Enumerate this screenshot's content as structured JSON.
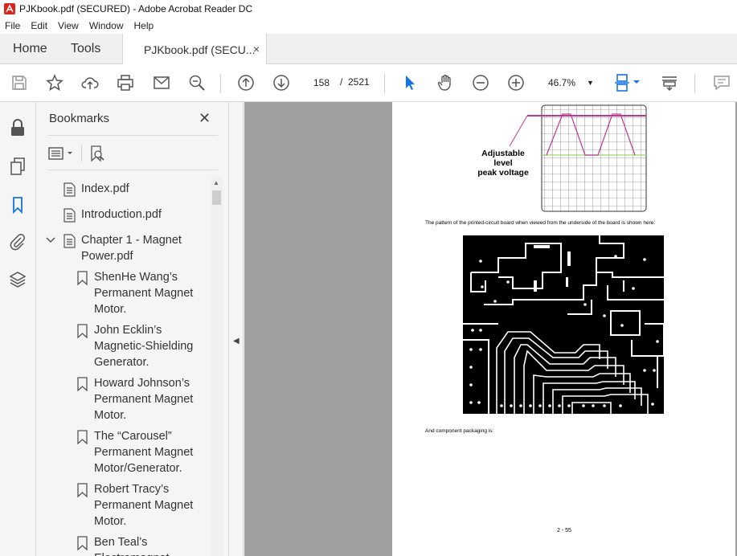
{
  "window": {
    "title": "PJKbook.pdf (SECURED) - Adobe Acrobat Reader DC"
  },
  "menu": [
    "File",
    "Edit",
    "View",
    "Window",
    "Help"
  ],
  "tabs": {
    "home": "Home",
    "tools": "Tools",
    "document": "PJKbook.pdf (SECU...",
    "close": "×"
  },
  "toolbar": {
    "page_current": "158",
    "page_sep": "/",
    "page_total": "2521",
    "zoom": "46.7%"
  },
  "bookmarks": {
    "title": "Bookmarks",
    "close": "✕",
    "items": [
      {
        "label": "Index.pdf"
      },
      {
        "label": "Introduction.pdf"
      },
      {
        "label": "Chapter 1 - Magnet Power.pdf"
      },
      {
        "label": "ShenHe Wang’s Permanent Magnet Motor."
      },
      {
        "label": "John Ecklin’s Magnetic-Shielding Generator."
      },
      {
        "label": "Howard Johnson’s Permanent Magnet Motor."
      },
      {
        "label": "The “Carousel” Permanent Magnet Motor/Generator."
      },
      {
        "label": "Robert Tracy’s Permanent Magnet Motor."
      },
      {
        "label": "Ben Teal’s Electromagnet"
      }
    ]
  },
  "document": {
    "figure_label": "Adjustable\nlevel\npeak voltage",
    "caption1": "The pattern of the printed-circuit board when viewed from the underside of the board is shown here:",
    "caption2": "And component packaging is:",
    "page_number": "2 - 55"
  },
  "colors": {
    "accent_blue": "#1473e6",
    "waveform": "#c0398f",
    "level_line": "#9bd36b"
  }
}
